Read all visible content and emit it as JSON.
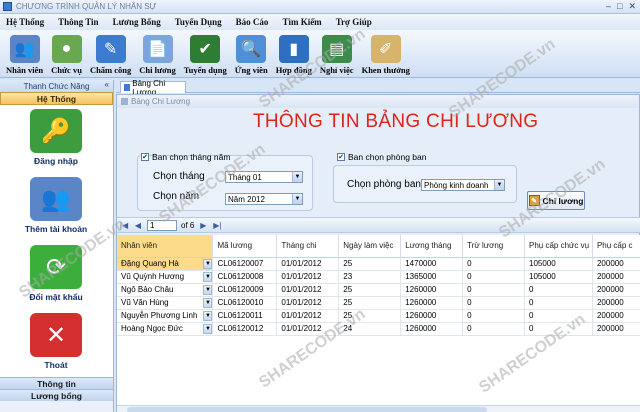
{
  "window": {
    "title": "CHƯƠNG TRÌNH QUẢN LÝ NHÂN SỰ",
    "controls": [
      "–",
      "□",
      "✕"
    ]
  },
  "menu": [
    "Hệ Thống",
    "Thông Tin",
    "Lương Bổng",
    "Tuyển Dụng",
    "Báo Cáo",
    "Tìm Kiếm",
    "Trợ Giúp"
  ],
  "toolbar": [
    {
      "label": "Nhân viên",
      "icon": "people-icon",
      "color": "#5a86c8",
      "glyph": "👥"
    },
    {
      "label": "Chức vụ",
      "icon": "alien-icon",
      "color": "#6aa84f",
      "glyph": "●"
    },
    {
      "label": "Chấm công",
      "icon": "pencil-icon",
      "color": "#3b7bd0",
      "glyph": "✎"
    },
    {
      "label": "Chi lương",
      "icon": "document-icon",
      "color": "#7aa6dc",
      "glyph": "📄"
    },
    {
      "label": "Tuyển dụng",
      "icon": "hire-icon",
      "color": "#2e7d32",
      "glyph": "✔"
    },
    {
      "label": "Ứng viên",
      "icon": "search-person-icon",
      "color": "#4f8fd8",
      "glyph": "🔍"
    },
    {
      "label": "Hợp đồng",
      "icon": "book-icon",
      "color": "#2f6fbf",
      "glyph": "▮"
    },
    {
      "label": "Nghỉ việc",
      "icon": "books-icon",
      "color": "#3c8d4a",
      "glyph": "▤"
    },
    {
      "label": "Khen thưởng",
      "icon": "scroll-icon",
      "color": "#d8b46a",
      "glyph": "✐"
    }
  ],
  "sidebar": {
    "header": "Thanh Chức Năng",
    "group": "Hệ Thống",
    "items": [
      {
        "label": "Đăng nhập",
        "icon": "key-icon",
        "color": "#3d9c3d",
        "glyph": "🔑"
      },
      {
        "label": "Thêm tài khoản",
        "icon": "users-icon",
        "color": "#5a86c8",
        "glyph": "👥"
      },
      {
        "label": "Đổi mật khẩu",
        "icon": "refresh-icon",
        "color": "#3bae3b",
        "glyph": "⟳"
      },
      {
        "label": "Thoát",
        "icon": "close-icon",
        "color": "#d32f2f",
        "glyph": "✕"
      }
    ],
    "bottom": [
      "Thông tin",
      "Lương bổng"
    ]
  },
  "tabs": {
    "active": "Bảng Chi Lương"
  },
  "form": {
    "window_title": "Bảng Chi Lương",
    "heading": "THÔNG TIN BẢNG CHI LƯƠNG",
    "month_year_group": {
      "checkbox_label": "Ban chọn tháng năm",
      "month_label": "Chọn tháng",
      "month_value": "Tháng 01",
      "year_label": "Chọn năm",
      "year_value": "Năm 2012"
    },
    "department_group": {
      "checkbox_label": "Ban chọn phòng ban",
      "dept_label": "Chọn phòng ban",
      "dept_value": "Phòng kinh doanh"
    },
    "submit_label": "Chi lương",
    "navigator": {
      "first": "|◀",
      "prev": "◀",
      "position": "1",
      "of": "of 6",
      "next": "▶",
      "last": "▶|"
    }
  },
  "grid": {
    "columns": [
      "Nhân viên",
      "Mã lương",
      "Tháng chi",
      "Ngày làm việc",
      "Lương tháng",
      "Trừ lương",
      "Phụ cấp chức vụ",
      "Phụ cấp c"
    ],
    "rows": [
      [
        "Đặng Quang Hà",
        "CL06120007",
        "01/01/2012",
        "25",
        "1470000",
        "0",
        "105000",
        "200000"
      ],
      [
        "Vũ Quỳnh Hương",
        "CL06120008",
        "01/01/2012",
        "23",
        "1365000",
        "0",
        "105000",
        "200000"
      ],
      [
        "Ngô Bảo Châu",
        "CL06120009",
        "01/01/2012",
        "25",
        "1260000",
        "0",
        "0",
        "200000"
      ],
      [
        "Vũ Văn Hùng",
        "CL06120010",
        "01/01/2012",
        "25",
        "1260000",
        "0",
        "0",
        "200000"
      ],
      [
        "Nguyễn Phương Linh",
        "CL06120011",
        "01/01/2012",
        "25",
        "1260000",
        "0",
        "0",
        "200000"
      ],
      [
        "Hoàng Ngọc Đức",
        "CL06120012",
        "01/01/2012",
        "24",
        "1260000",
        "0",
        "0",
        "200000"
      ]
    ]
  },
  "watermark": "SHARECODE.vn"
}
